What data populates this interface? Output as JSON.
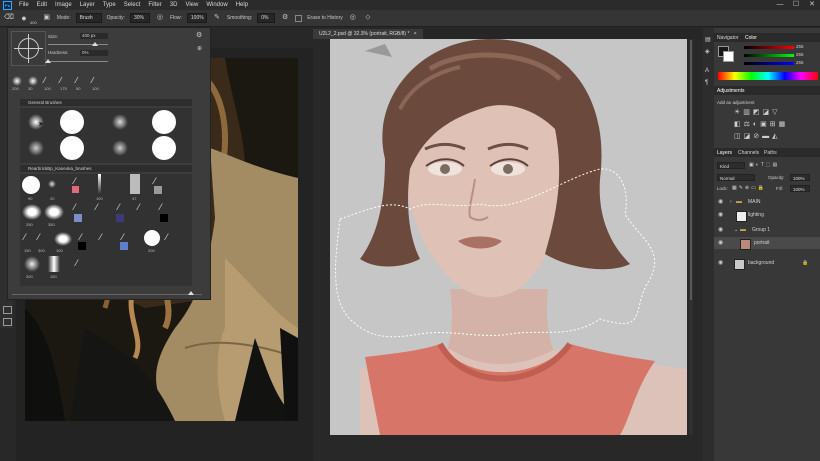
{
  "menu": {
    "items": [
      "File",
      "Edit",
      "Image",
      "Layer",
      "Type",
      "Select",
      "Filter",
      "3D",
      "View",
      "Window",
      "Help"
    ],
    "app_icon": "Ps",
    "window_controls": {
      "minimize": "—",
      "maximize": "☐",
      "close": "✕"
    }
  },
  "options_bar": {
    "mode_label": "Mode:",
    "mode_value": "Brush",
    "opacity_label": "Opacity:",
    "opacity_value": "30%",
    "flow_label": "Flow:",
    "flow_value": "100%",
    "smoothing_label": "Smoothing:",
    "smoothing_value": "0%",
    "erase_to_history_label": "Erase to History",
    "brush_size_value": "400"
  },
  "brush_panel": {
    "size_label": "Size:",
    "size_value": "400 px",
    "hardness_label": "Hardness:",
    "hardness_value": "0%",
    "size_slider_fraction": 0.78,
    "hardness_slider_fraction": 0.0,
    "recent_sizes": [
      "200",
      "30",
      "100",
      "175",
      "50",
      "100"
    ],
    "group1_title": "General Brushes",
    "group2_title": "RearbrickBp_Kaneoka_brushes",
    "group2_labels_row1": [
      "90",
      "20",
      "",
      "",
      "100",
      "47",
      ""
    ],
    "group2_labels_row2": [
      "250",
      "350",
      "",
      "",
      "",
      "",
      "",
      "",
      ""
    ],
    "group2_labels_row3": [
      "150",
      "300",
      "100",
      "",
      "",
      "",
      "",
      "200"
    ],
    "group2_labels_row4": [
      "300",
      "150",
      ""
    ]
  },
  "document": {
    "tab_title": "U2L2_2.psd @ 32.3% (portrait, RGB/8) *",
    "tab_close": "×"
  },
  "panels": {
    "navigator_tab": "Navigator",
    "color_tab": "Color",
    "color_values": [
      "255",
      "255",
      "255"
    ],
    "adjustments_tab": "Adjustments",
    "adjustments_hint": "Add an adjustment",
    "layers_tab": "Layers",
    "channels_tab": "Channels",
    "paths_tab": "Paths",
    "kind_label": "Kind",
    "blend_mode": "Normal",
    "opacity_label": "Opacity:",
    "opacity_value": "100%",
    "lock_label": "Lock:",
    "fill_label": "Fill:",
    "fill_value": "100%",
    "layers": [
      {
        "name": "MAIN",
        "type": "group"
      },
      {
        "name": "lighting",
        "type": "layer"
      },
      {
        "name": "Group 1",
        "type": "group"
      },
      {
        "name": "portrait",
        "type": "layer"
      },
      {
        "name": "background",
        "type": "layer"
      }
    ]
  },
  "colors": {
    "app_bg": "#282828",
    "panel_bg": "#383838",
    "accent": "#31a8ff",
    "shirt": "#d77668",
    "skin": "#d9b9ad",
    "hair": "#6b4a3d"
  }
}
